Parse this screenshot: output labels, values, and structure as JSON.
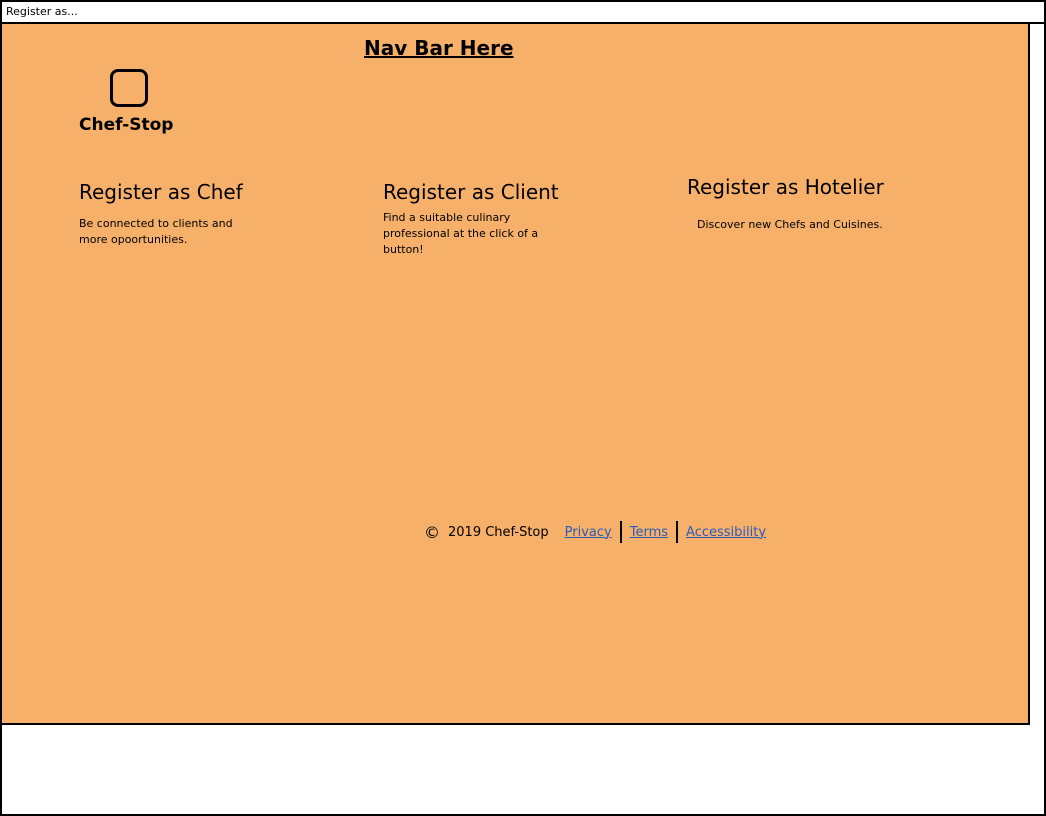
{
  "window": {
    "title": "Register as..."
  },
  "nav": {
    "label": "Nav Bar Here"
  },
  "logo": {
    "icon": "square-placeholder-icon",
    "name": "Chef-Stop"
  },
  "register_options": [
    {
      "title": "Register as Chef",
      "description": "Be connected to clients and more opoortunities."
    },
    {
      "title": "Register as Client",
      "description": "Find a suitable culinary professional at the click of a button!"
    },
    {
      "title": "Register as Hotelier",
      "description": "Discover new Chefs and Cuisines."
    }
  ],
  "footer": {
    "copyright_symbol": "©",
    "copyright_text": "2019 Chef-Stop",
    "links": [
      {
        "label": "Privacy"
      },
      {
        "label": "Terms"
      },
      {
        "label": "Accessibility"
      }
    ]
  },
  "colors": {
    "canvas_background": "#f6b06a",
    "link": "#2a5bb8"
  }
}
